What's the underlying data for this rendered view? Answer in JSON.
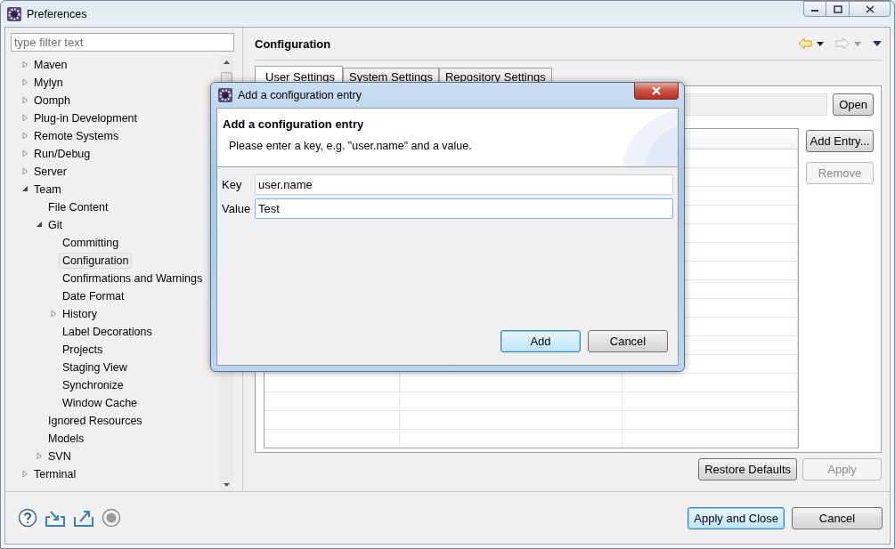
{
  "window": {
    "title": "Preferences"
  },
  "filter": {
    "placeholder": "type filter text"
  },
  "tree": [
    {
      "label": "Maven",
      "kind": "branch",
      "expanded": false,
      "selected": false
    },
    {
      "label": "Mylyn",
      "kind": "branch",
      "expanded": false,
      "selected": false
    },
    {
      "label": "Oomph",
      "kind": "branch",
      "expanded": false,
      "selected": false
    },
    {
      "label": "Plug-in Development",
      "kind": "branch",
      "expanded": false,
      "selected": false
    },
    {
      "label": "Remote Systems",
      "kind": "branch",
      "expanded": false,
      "selected": false
    },
    {
      "label": "Run/Debug",
      "kind": "branch",
      "expanded": false,
      "selected": false
    },
    {
      "label": "Server",
      "kind": "branch",
      "expanded": false,
      "selected": false
    },
    {
      "label": "Team",
      "kind": "branch",
      "expanded": true,
      "selected": false,
      "children": [
        {
          "label": "File Content",
          "kind": "leaf",
          "selected": false
        },
        {
          "label": "Git",
          "kind": "branch",
          "expanded": true,
          "selected": false,
          "children": [
            {
              "label": "Committing",
              "kind": "leaf",
              "selected": false
            },
            {
              "label": "Configuration",
              "kind": "leaf",
              "selected": true
            },
            {
              "label": "Confirmations and Warnings",
              "kind": "leaf",
              "selected": false
            },
            {
              "label": "Date Format",
              "kind": "leaf",
              "selected": false
            },
            {
              "label": "History",
              "kind": "branch",
              "expanded": false,
              "selected": false
            },
            {
              "label": "Label Decorations",
              "kind": "leaf",
              "selected": false
            },
            {
              "label": "Projects",
              "kind": "leaf",
              "selected": false
            },
            {
              "label": "Staging View",
              "kind": "leaf",
              "selected": false
            },
            {
              "label": "Synchronize",
              "kind": "leaf",
              "selected": false
            },
            {
              "label": "Window Cache",
              "kind": "leaf",
              "selected": false
            }
          ]
        },
        {
          "label": "Ignored Resources",
          "kind": "leaf",
          "selected": false
        },
        {
          "label": "Models",
          "kind": "leaf",
          "selected": false
        },
        {
          "label": "SVN",
          "kind": "branch",
          "expanded": false,
          "selected": false
        }
      ]
    },
    {
      "label": "Terminal",
      "kind": "branch",
      "expanded": false,
      "selected": false
    }
  ],
  "page": {
    "title": "Configuration",
    "tabs": [
      {
        "label": "User Settings",
        "selected": true
      },
      {
        "label": "System Settings",
        "selected": false
      },
      {
        "label": "Repository Settings",
        "selected": false
      }
    ],
    "open_button": "Open",
    "side_buttons": [
      {
        "label": "Add Entry...",
        "disabled": false
      },
      {
        "label": "Remove",
        "disabled": true
      }
    ],
    "page_buttons": [
      {
        "label": "Restore Defaults",
        "disabled": false
      },
      {
        "label": "Apply",
        "disabled": true
      }
    ]
  },
  "footer_buttons": [
    {
      "label": "Apply and Close",
      "default": true
    },
    {
      "label": "Cancel",
      "default": false
    }
  ],
  "dialog": {
    "title": "Add a configuration entry",
    "heading": "Add a configuration entry",
    "message": "Please enter a key, e.g. \"user.name\" and a value.",
    "fields": [
      {
        "label": "Key",
        "value": "user.name",
        "focused": false
      },
      {
        "label": "Value",
        "value": "Test",
        "focused": true
      }
    ],
    "buttons": [
      {
        "label": "Add",
        "default": true
      },
      {
        "label": "Cancel",
        "default": false
      }
    ]
  }
}
